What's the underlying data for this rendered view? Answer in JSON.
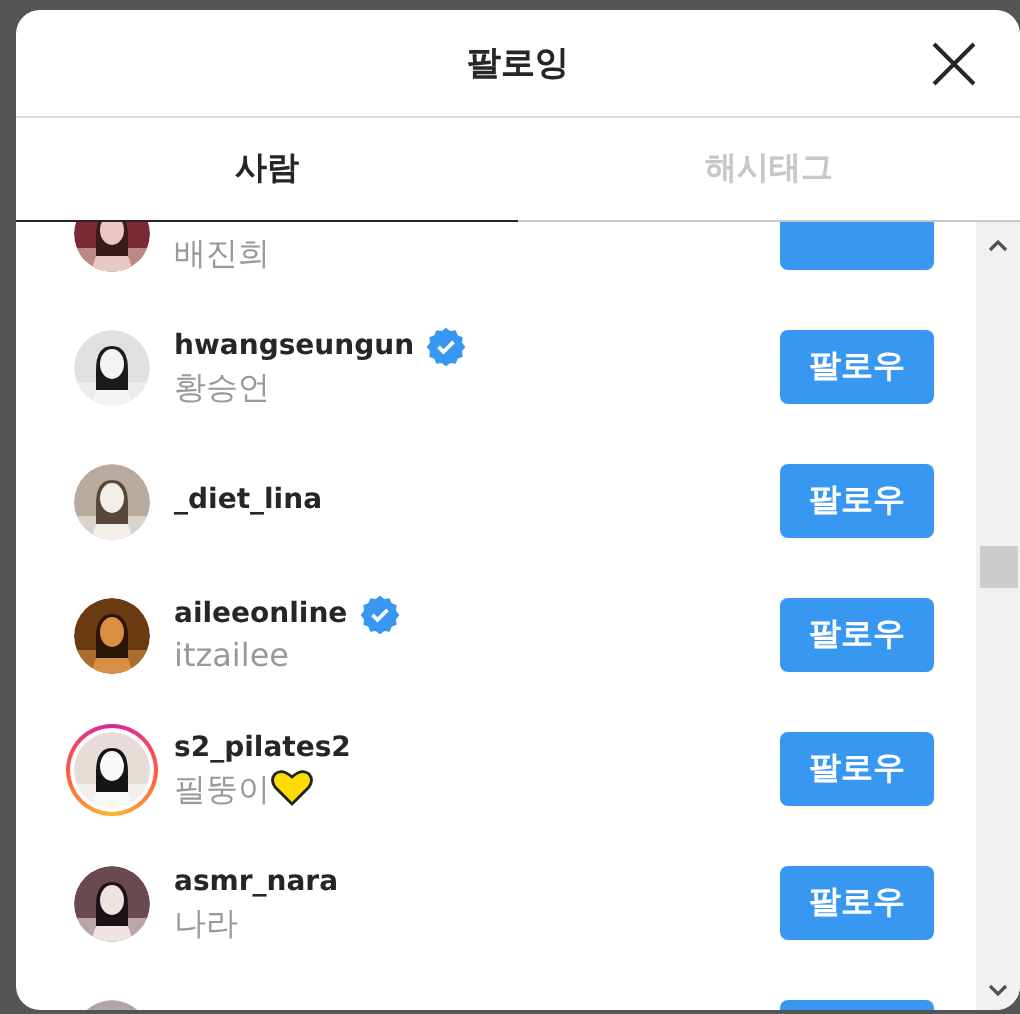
{
  "dialog": {
    "title": "팔로잉"
  },
  "tabs": [
    {
      "label": "사람",
      "selected": true
    },
    {
      "label": "해시태그",
      "selected": false
    }
  ],
  "accounts": [
    {
      "full_name": "배진희",
      "story_ring": false
    },
    {
      "username": "hwangseungun",
      "full_name": "황승언",
      "verified": true,
      "story_ring": false,
      "button": "팔로우"
    },
    {
      "username": "_diet_lina",
      "verified": false,
      "story_ring": false,
      "button": "팔로우"
    },
    {
      "username": "aileeonline",
      "full_name": "itzailee",
      "verified": true,
      "story_ring": false,
      "button": "팔로우"
    },
    {
      "username": "s2_pilates2",
      "full_name": "필뚱이",
      "heart": true,
      "verified": false,
      "story_ring": true,
      "button": "팔로우"
    },
    {
      "username": "asmr_nara",
      "full_name": "나라",
      "verified": false,
      "story_ring": false,
      "button": "팔로우"
    },
    {
      "story_ring": false
    }
  ]
}
